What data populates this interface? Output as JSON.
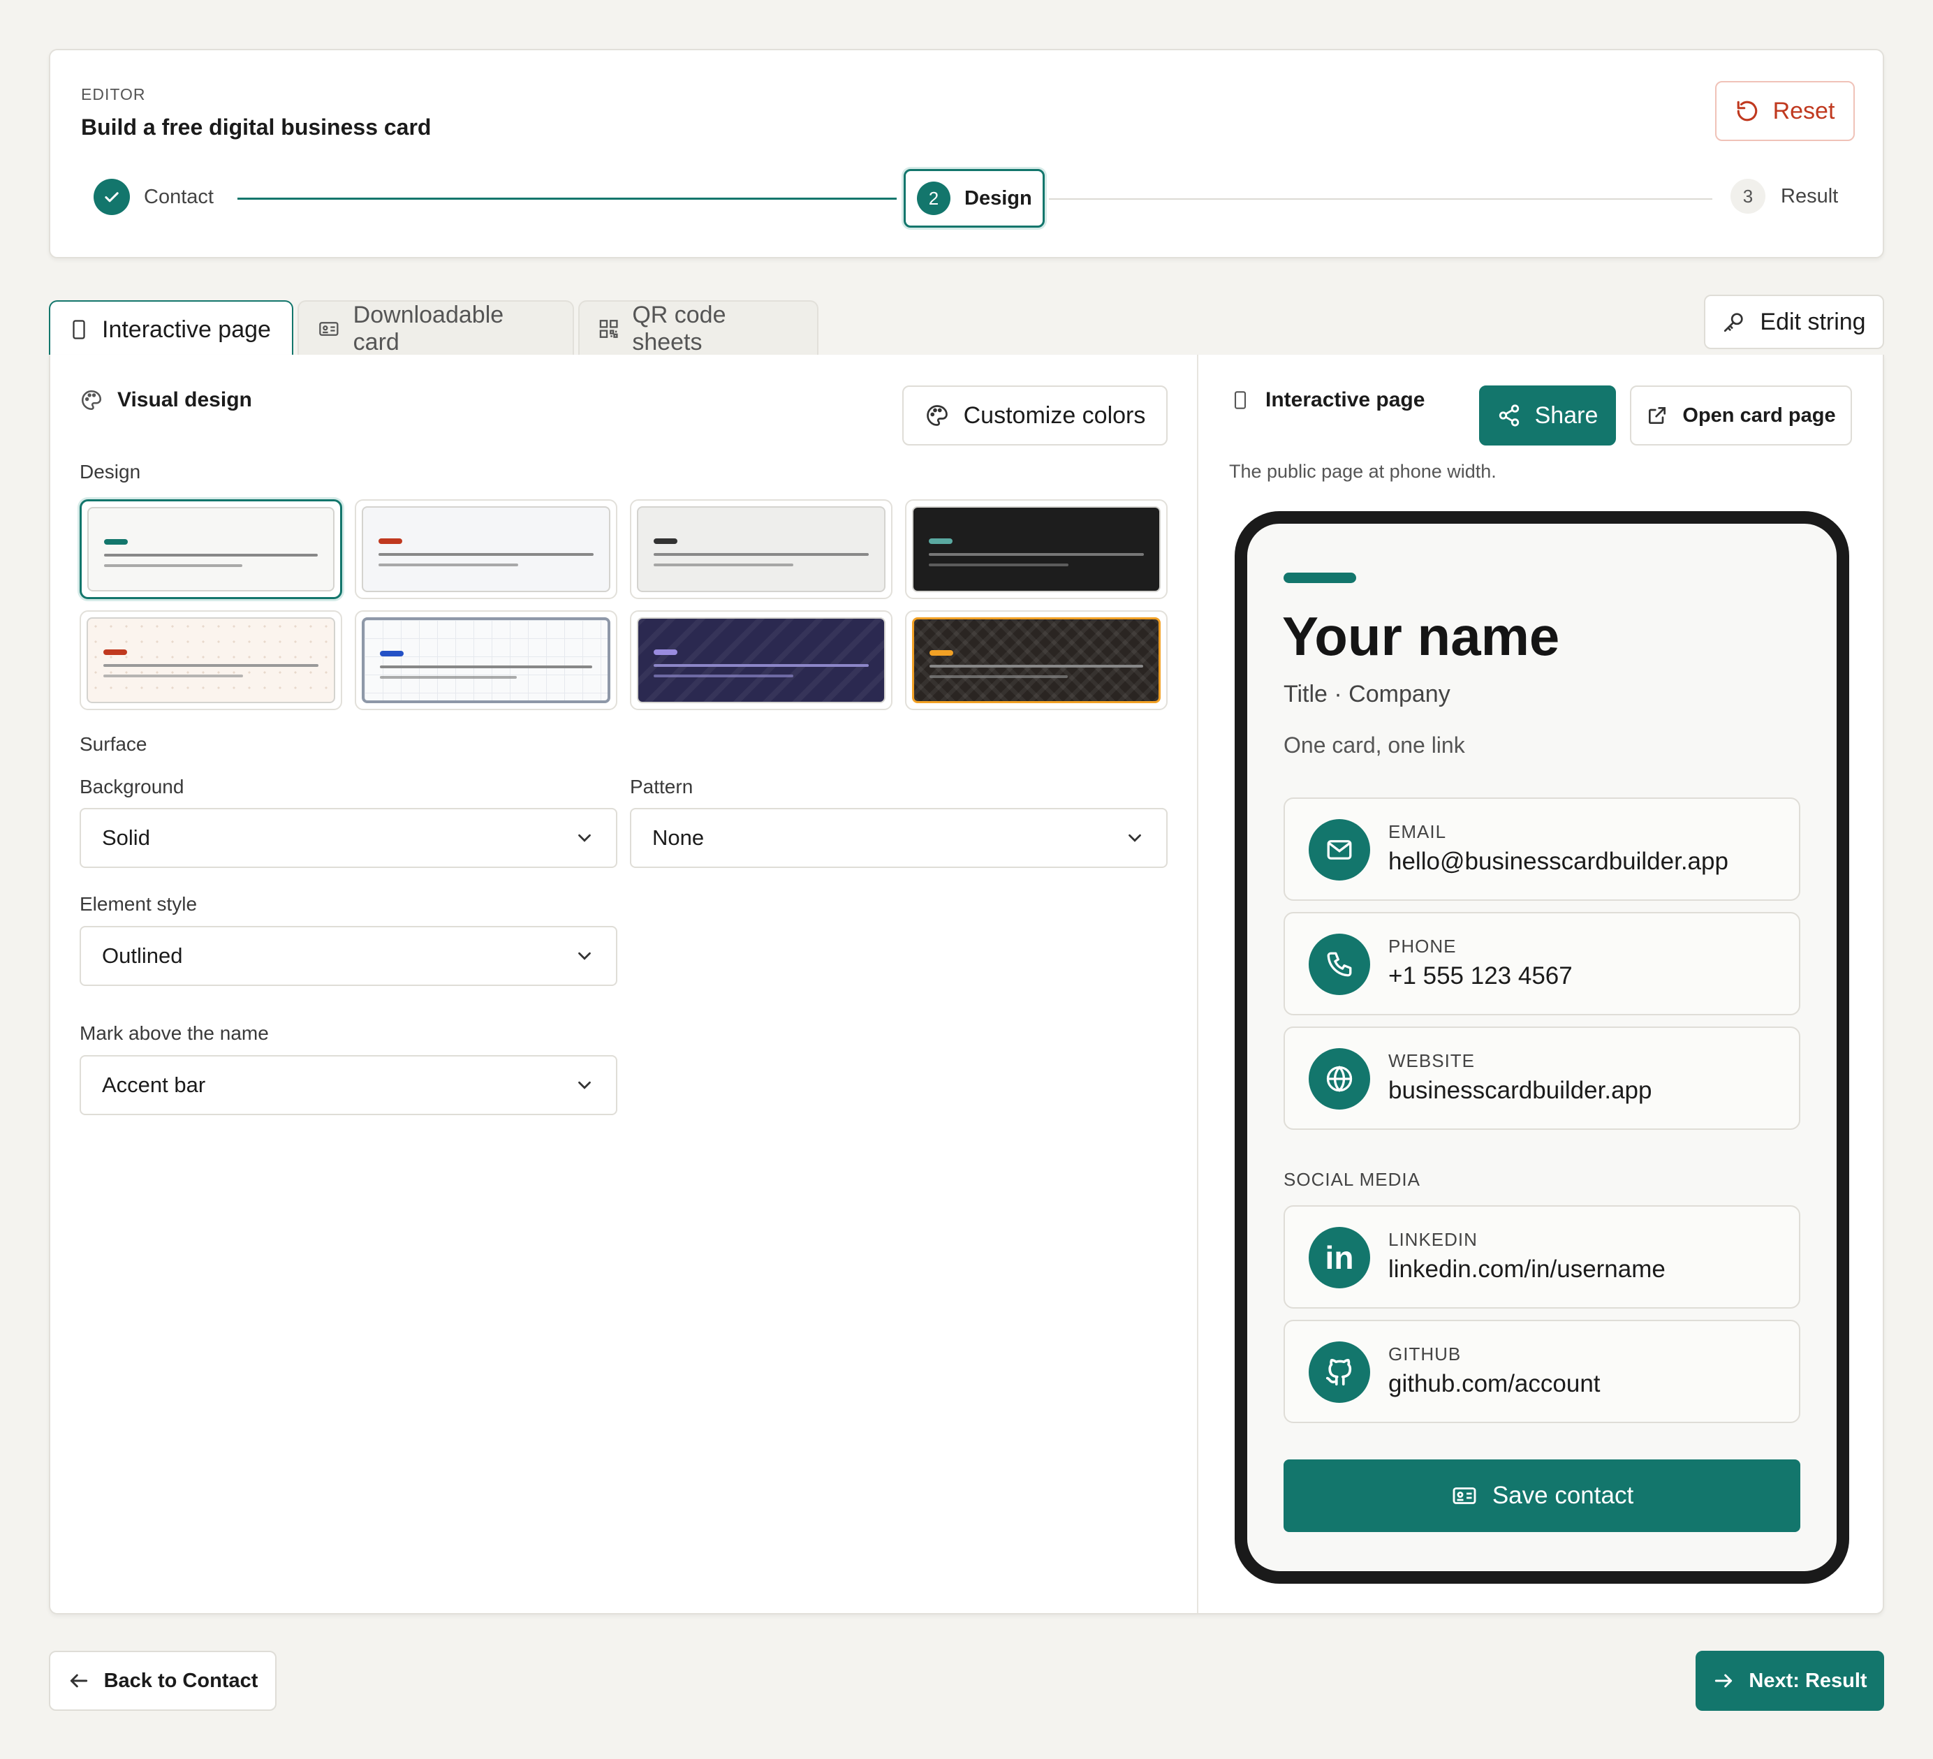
{
  "header": {
    "eyebrow": "EDITOR",
    "title": "Build a free digital business card",
    "reset_label": "Reset"
  },
  "steps": [
    {
      "label": "Contact",
      "status": "done"
    },
    {
      "label": "Design",
      "number": "2",
      "status": "current"
    },
    {
      "label": "Result",
      "number": "3",
      "status": "todo"
    }
  ],
  "tabs": [
    {
      "label": "Interactive page",
      "active": true
    },
    {
      "label": "Downloadable card",
      "active": false
    },
    {
      "label": "QR code sheets",
      "active": false
    }
  ],
  "edit_string_label": "Edit string",
  "left": {
    "section_title": "Visual design",
    "customize_label": "Customize colors",
    "design_label": "Design",
    "designs": [
      {
        "bg": "#f7f7f5",
        "accent": "#13766c",
        "line": "#888",
        "selected": true
      },
      {
        "bg": "#f5f6f8",
        "accent": "#c0391f",
        "line": "#888",
        "selected": false
      },
      {
        "bg": "#eeeeec",
        "accent": "#333333",
        "line": "#888",
        "selected": false
      },
      {
        "bg": "#1d1d1d",
        "accent": "#5aa9a1",
        "line": "#777",
        "selected": false
      },
      {
        "bg": "#fbf4ee",
        "accent": "#c0391f",
        "line": "#999",
        "selected": false
      },
      {
        "bg": "#f9fafb",
        "accent": "#2451c6",
        "line": "#888",
        "selected": false
      },
      {
        "bg": "#2b2950",
        "accent": "#9a8ce0",
        "line": "#8c86c8",
        "selected": false
      },
      {
        "bg": "#2a2522",
        "accent": "#f2a125",
        "line": "#888",
        "selected": false
      }
    ],
    "surface_label": "Surface",
    "background": {
      "label": "Background",
      "value": "Solid"
    },
    "pattern": {
      "label": "Pattern",
      "value": "None"
    },
    "element_style": {
      "label": "Element style",
      "value": "Outlined"
    },
    "mark": {
      "label": "Mark above the name",
      "value": "Accent bar"
    }
  },
  "right": {
    "title": "Interactive page",
    "share_label": "Share",
    "open_label": "Open card page",
    "subtitle": "The public page at phone width.",
    "phone": {
      "name": "Your name",
      "title_company": "Title · Company",
      "tagline": "One card, one link",
      "contacts": [
        {
          "type": "EMAIL",
          "value": "hello@businesscardbuilder.app",
          "icon": "mail-icon"
        },
        {
          "type": "PHONE",
          "value": "+1 555 123 4567",
          "icon": "phone-icon"
        },
        {
          "type": "WEBSITE",
          "value": "businesscardbuilder.app",
          "icon": "globe-icon"
        }
      ],
      "social_label": "SOCIAL MEDIA",
      "social": [
        {
          "type": "LINKEDIN",
          "value": "linkedin.com/in/username",
          "icon": "linkedin-icon"
        },
        {
          "type": "GITHUB",
          "value": "github.com/account",
          "icon": "github-icon"
        }
      ],
      "save_label": "Save contact"
    }
  },
  "footer": {
    "back_label": "Back to Contact",
    "next_label": "Next: Result"
  },
  "colors": {
    "accent": "#13766c",
    "danger": "#c0391f",
    "page_bg": "#f4f3ef"
  }
}
